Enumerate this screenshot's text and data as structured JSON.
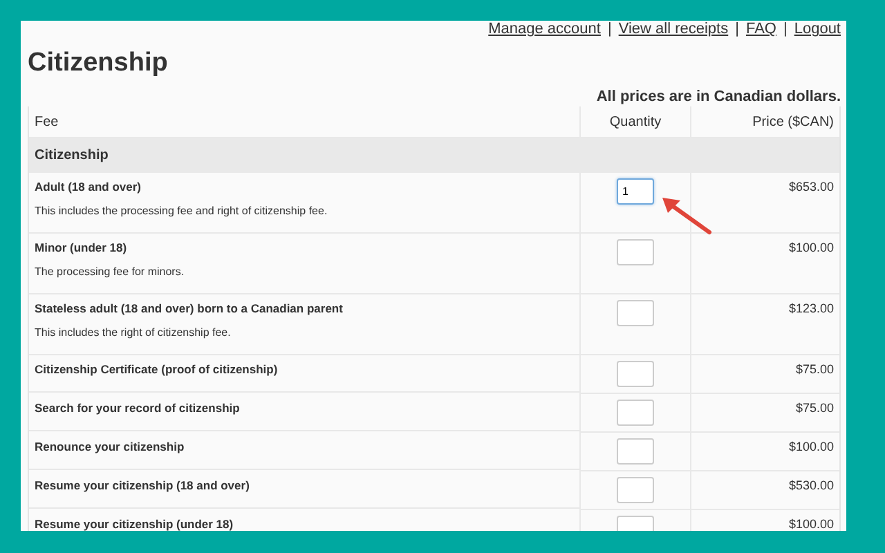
{
  "top_links": [
    "Manage account",
    "View all receipts",
    "FAQ",
    "Logout"
  ],
  "link_separator": "|",
  "title": "Citizenship",
  "currency_note": "All prices are in Canadian dollars.",
  "table": {
    "columns": [
      "Fee",
      "Quantity",
      "Price ($CAN)"
    ],
    "group": "Citizenship",
    "rows": [
      {
        "name": "Adult (18 and over)",
        "description": "This includes the processing fee and right of citizenship fee.",
        "quantity": "1",
        "focused": true,
        "price": "$653.00"
      },
      {
        "name": "Minor (under 18)",
        "description": "The processing fee for minors.",
        "quantity": "",
        "focused": false,
        "price": "$100.00"
      },
      {
        "name": "Stateless adult (18 and over) born to a Canadian parent",
        "description": "This includes the right of citizenship fee.",
        "quantity": "",
        "focused": false,
        "price": "$123.00"
      },
      {
        "name": "Citizenship Certificate (proof of citizenship)",
        "focused": false,
        "price": "$75.00"
      },
      {
        "name": "Search for your record of citizenship",
        "focused": false,
        "price": "$75.00"
      },
      {
        "name": "Renounce your citizenship",
        "focused": false,
        "price": "$100.00"
      },
      {
        "name": "Resume your citizenship (18 and over)",
        "focused": false,
        "price": "$530.00"
      },
      {
        "name": "Resume your citizenship (under 18)",
        "focused": false,
        "price": "$100.00"
      }
    ]
  }
}
